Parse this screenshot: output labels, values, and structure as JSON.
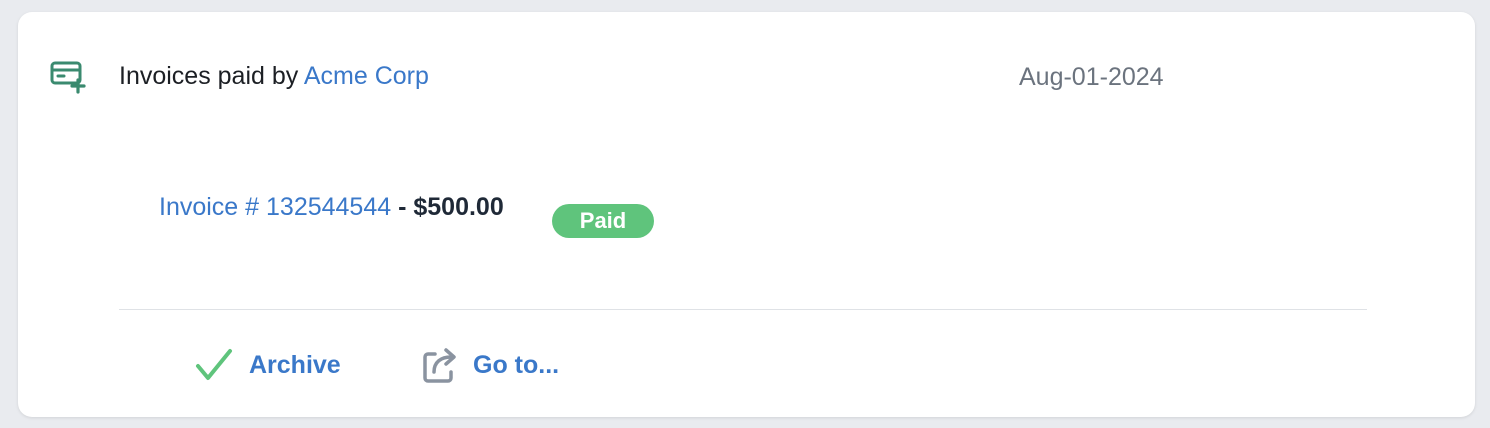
{
  "activity": {
    "icon": "invoice-add-icon",
    "title_prefix": "Invoices paid by",
    "company": "Acme Corp",
    "date": "Aug-01-2024"
  },
  "invoice": {
    "link_text": "Invoice # 132544544",
    "separator": " - ",
    "amount": "$500.00",
    "status": "Paid"
  },
  "actions": {
    "archive": {
      "label": "Archive",
      "icon": "check-icon"
    },
    "goto": {
      "label": "Go to...",
      "icon": "external-link-icon"
    }
  },
  "colors": {
    "accent": "#3a78c9",
    "icon_green": "#3a8a6f",
    "status_paid": "#5fc47c",
    "check_green": "#5fc47c",
    "muted": "#6b737e"
  }
}
